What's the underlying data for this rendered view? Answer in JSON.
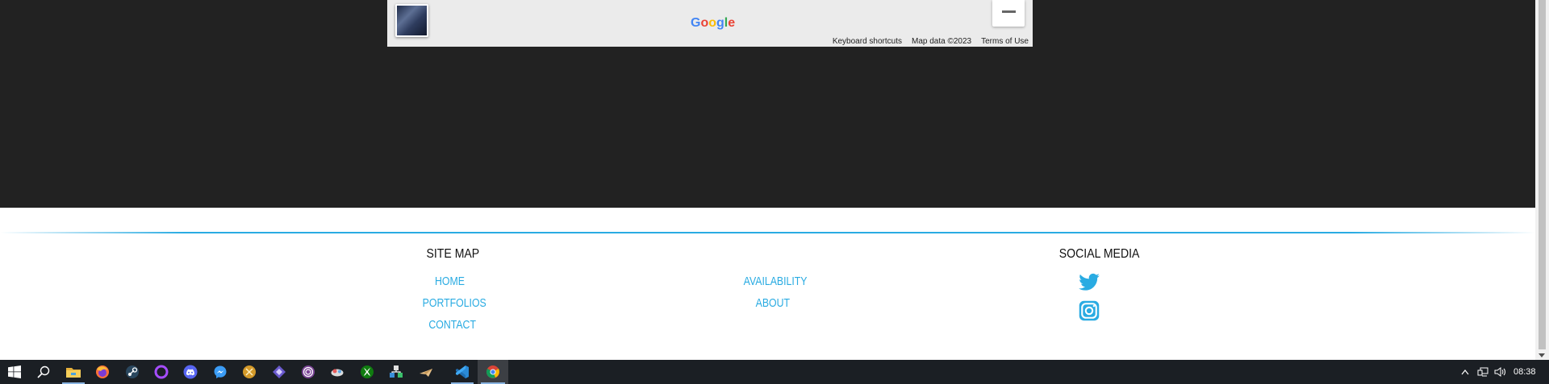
{
  "map": {
    "logo_letters": [
      "G",
      "o",
      "o",
      "g",
      "l",
      "e"
    ],
    "logo_colors": [
      "#4285f4",
      "#ea4335",
      "#fbbc05",
      "#4285f4",
      "#34a853",
      "#ea4335"
    ],
    "keyboard_shortcuts": "Keyboard shortcuts",
    "map_data": "Map data ©2023",
    "terms": "Terms of Use"
  },
  "footer": {
    "accent_color": "#29abe2",
    "site_map": {
      "title": "SITE MAP",
      "links_col1": [
        "HOME",
        "PORTFOLIOS",
        "CONTACT"
      ],
      "links_col2": [
        "AVAILABILITY",
        "ABOUT"
      ]
    },
    "social": {
      "title": "SOCIAL MEDIA",
      "icons": [
        "twitter-icon",
        "instagram-icon"
      ]
    }
  },
  "taskbar": {
    "icons": [
      "start-icon",
      "search-icon",
      "file-explorer-icon",
      "firefox-icon",
      "steam-icon",
      "circle-app-icon",
      "discord-icon",
      "messenger-icon",
      "ball-app-icon",
      "diamond-app-icon",
      "tor-browser-icon",
      "cloud-game-icon",
      "xbox-icon",
      "network-tool-icon",
      "paper-plane-app-icon",
      "vscode-icon",
      "chrome-icon"
    ],
    "clock": "08:38"
  }
}
